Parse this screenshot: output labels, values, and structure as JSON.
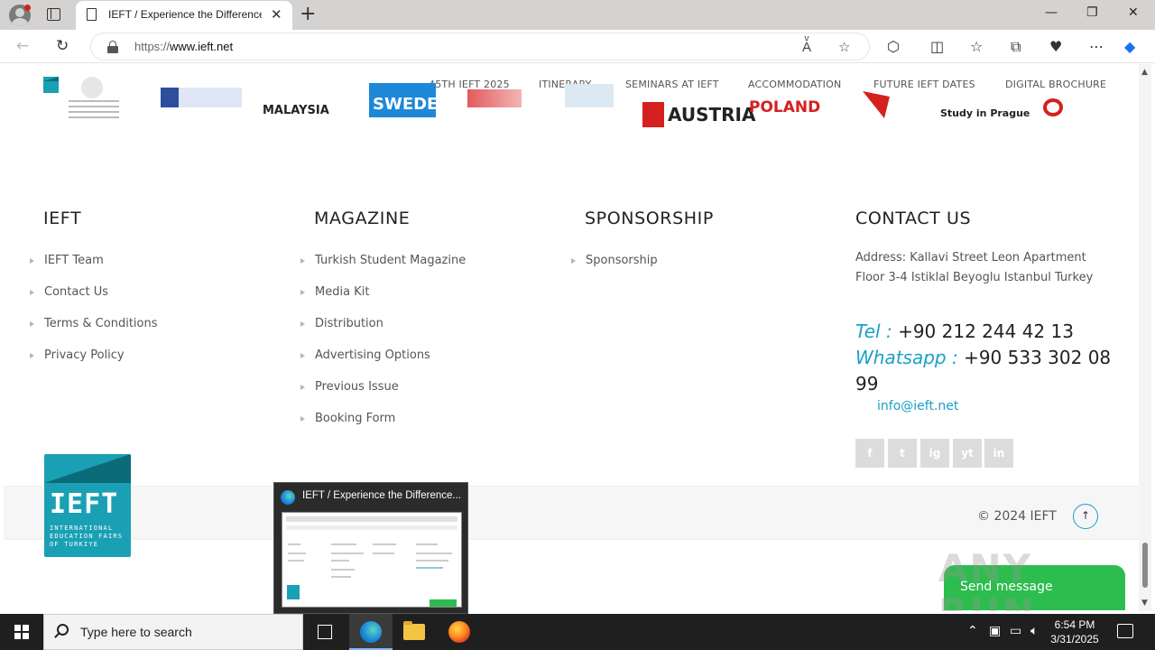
{
  "browser": {
    "tab_title": "IEFT / Experience the Difference...",
    "url_prefix": "https://",
    "url_host": "www.ieft.net"
  },
  "site_nav": {
    "items": [
      "45TH IEFT 2025",
      "ITINERARY",
      "SEMINARS AT IEFT",
      "ACCOMMODATION",
      "FUTURE IEFT DATES",
      "DIGITAL BROCHURE"
    ]
  },
  "partners": [
    "MALAYSIA",
    "SWEDEN",
    "AUSTRIA",
    "POLAND",
    "Study in Prague"
  ],
  "footer": {
    "ieft": {
      "title": "IEFT",
      "links": [
        "IEFT Team",
        "Contact Us",
        "Terms & Conditions",
        "Privacy Policy"
      ]
    },
    "magazine": {
      "title": "MAGAZINE",
      "links": [
        "Turkish Student Magazine",
        "Media Kit",
        "Distribution",
        "Advertising Options",
        "Previous Issue",
        "Booking Form"
      ]
    },
    "sponsorship": {
      "title": "SPONSORSHIP",
      "links": [
        "Sponsorship"
      ]
    },
    "contact": {
      "title": "CONTACT US",
      "address": "Address: Kallavi Street Leon Apartment Floor 3-4 Istiklal Beyoglu Istanbul Turkey",
      "tel_label": "Tel :",
      "tel": "+90 212 244 42 13",
      "whatsapp_label": "Whatsapp :",
      "whatsapp": "+90 533 302 08 99",
      "email": "info@ieft.net"
    },
    "social": [
      "f",
      "t",
      "ig",
      "yt",
      "in"
    ],
    "copyright": "© 2024 IEFT",
    "badge_word": "IEFT",
    "badge_sub": "INTERNATIONAL EDUCATION FAIRS OF TURKIYE"
  },
  "send_message": "Send message",
  "watermark": "ANY RUN",
  "taskbar": {
    "thumbnail_title": "IEFT / Experience the Difference...",
    "search_placeholder": "Type here to search",
    "time": "6:54 PM",
    "date": "3/31/2025"
  },
  "colors": {
    "accent": "#1aa0c8",
    "brand_teal": "#1aa0b4",
    "send_green": "#2dbd4e"
  }
}
